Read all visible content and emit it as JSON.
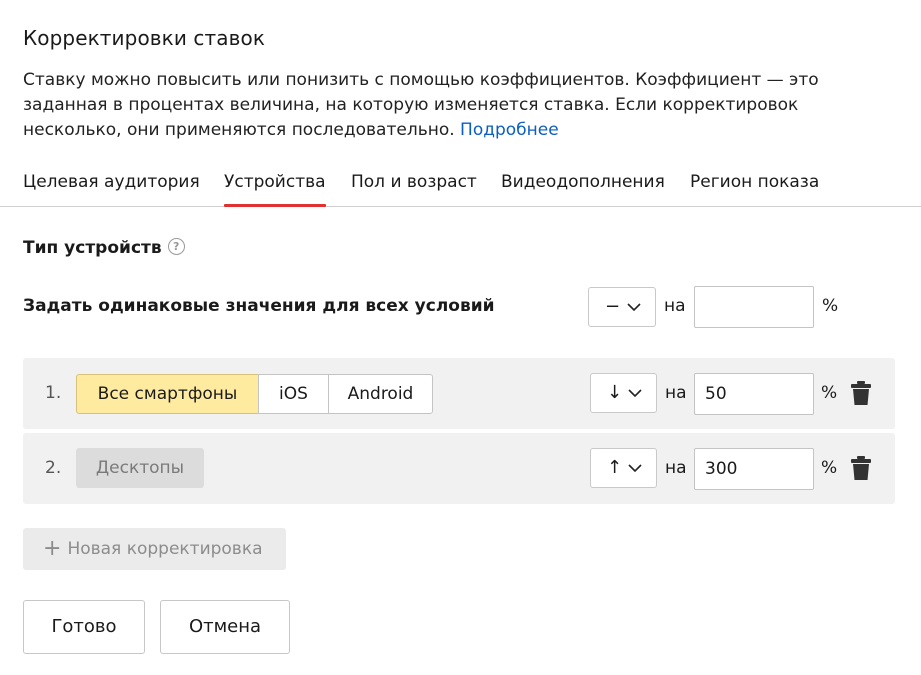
{
  "header": {
    "title": "Корректировки ставок",
    "description": "Ставку можно повысить или понизить с помощью коэффициентов. Коэффициент — это заданная в процентах величина, на которую изменяется ставка. Если корректировок несколько, они применяются последовательно.",
    "more_link": "Подробнее"
  },
  "tabs": [
    {
      "label": "Целевая аудитория",
      "active": false
    },
    {
      "label": "Устройства",
      "active": true
    },
    {
      "label": "Пол и возраст",
      "active": false
    },
    {
      "label": "Видеодополнения",
      "active": false
    },
    {
      "label": "Регион показа",
      "active": false
    }
  ],
  "section": {
    "title": "Тип устройств",
    "help_icon": "question-circle-icon",
    "help_glyph": "?"
  },
  "same_values": {
    "label": "Задать одинаковые значения для всех условий",
    "direction": "−",
    "on_label": "на",
    "value": "",
    "percent": "%"
  },
  "rows": [
    {
      "index": "1.",
      "options": [
        "Все смартфоны",
        "iOS",
        "Android"
      ],
      "selected": "Все смартфоны",
      "direction": "↓",
      "on_label": "на",
      "value": "50",
      "percent": "%"
    },
    {
      "index": "2.",
      "chip": "Десктопы",
      "direction": "↑",
      "on_label": "на",
      "value": "300",
      "percent": "%"
    }
  ],
  "new_adjustment": {
    "plus": "+",
    "label": "Новая корректировка"
  },
  "actions": {
    "done": "Готово",
    "cancel": "Отмена"
  },
  "colors": {
    "accent_tab": "#e0302f",
    "link": "#0b5fbf",
    "selected_segment": "#ffeba0"
  }
}
